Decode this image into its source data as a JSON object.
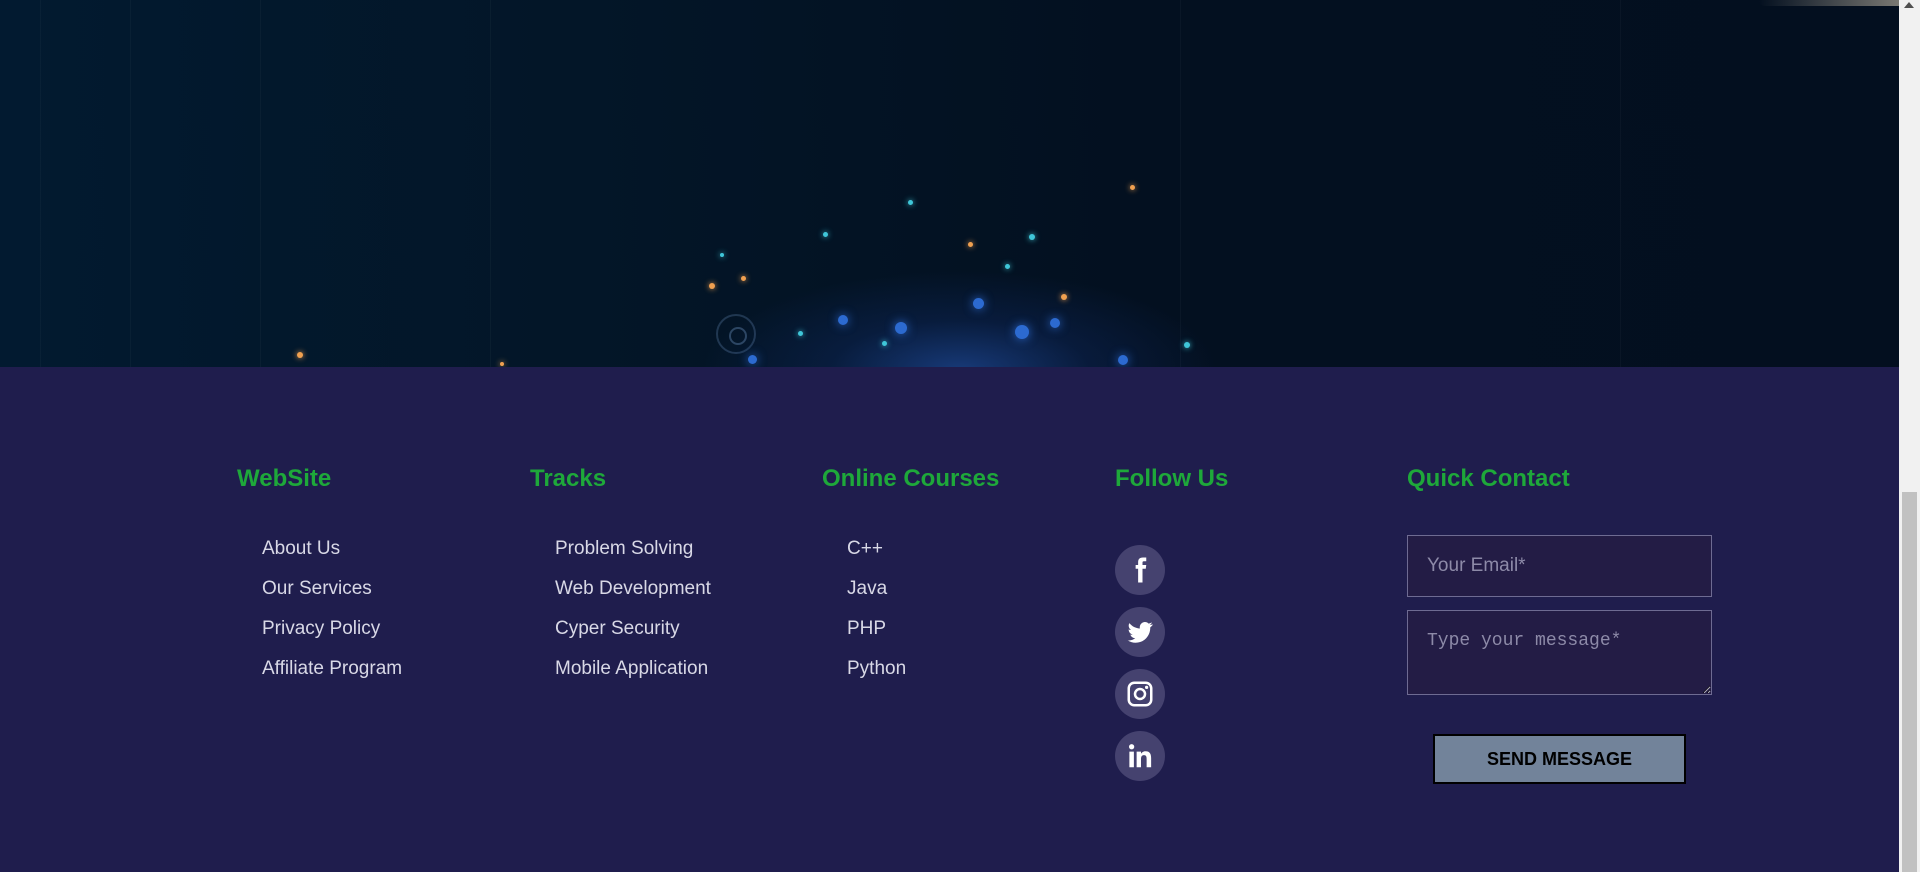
{
  "footer": {
    "website": {
      "title": "WebSite",
      "links": [
        "About Us",
        "Our Services",
        "Privacy Policy",
        "Affiliate Program"
      ]
    },
    "tracks": {
      "title": "Tracks",
      "links": [
        "Problem Solving",
        "Web Development",
        "Cyper Security",
        "Mobile Application"
      ]
    },
    "courses": {
      "title": "Online Courses",
      "links": [
        "C++",
        "Java",
        "PHP",
        "Python"
      ]
    },
    "follow": {
      "title": "Follow Us",
      "icons": [
        "facebook-icon",
        "twitter-icon",
        "instagram-icon",
        "linkedin-icon"
      ]
    },
    "contact": {
      "title": "Quick Contact",
      "email_placeholder": "Your Email*",
      "message_placeholder": "Type your message*",
      "send_label": "SEND MESSAGE"
    }
  },
  "colors": {
    "footer_bg": "#1f1d4d",
    "heading": "#1ea83a",
    "link": "#d8d8e6",
    "button_bg": "#72839a"
  }
}
